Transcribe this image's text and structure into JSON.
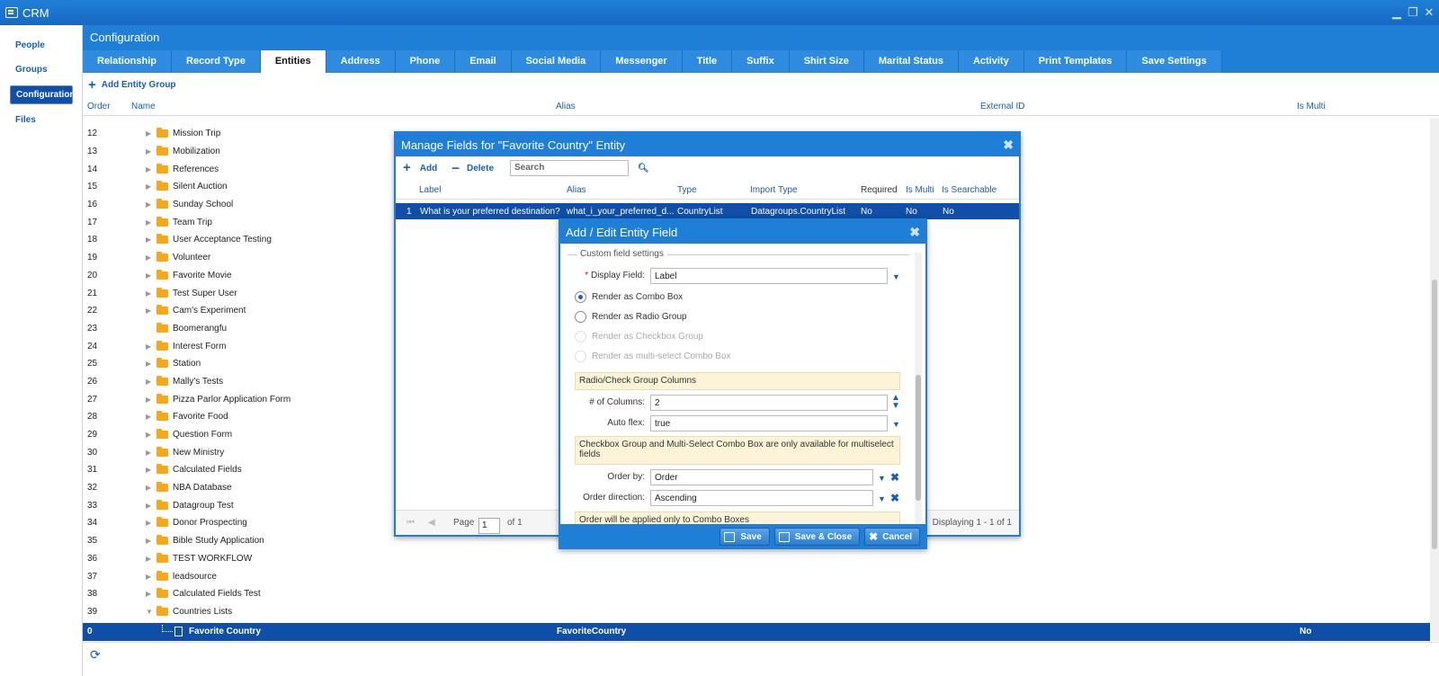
{
  "app": {
    "title": "CRM"
  },
  "sidebar": {
    "items": [
      {
        "label": "People"
      },
      {
        "label": "Groups"
      },
      {
        "label": "Configuration"
      },
      {
        "label": "Files"
      }
    ]
  },
  "config": {
    "title": "Configuration",
    "tabs": [
      "Relationship",
      "Record Type",
      "Entities",
      "Address",
      "Phone",
      "Email",
      "Social Media",
      "Messenger",
      "Title",
      "Suffix",
      "Shirt Size",
      "Marital Status",
      "Activity",
      "Print Templates",
      "Save Settings"
    ],
    "active_tab": "Entities",
    "add_group_label": "Add Entity Group",
    "columns": {
      "order": "Order",
      "name": "Name",
      "alias": "Alias",
      "external_id": "External ID",
      "is_multi": "Is Multi"
    },
    "rows": [
      {
        "order": "12",
        "name": "Mission Trip"
      },
      {
        "order": "13",
        "name": "Mobilization"
      },
      {
        "order": "14",
        "name": "References"
      },
      {
        "order": "15",
        "name": "Silent Auction"
      },
      {
        "order": "16",
        "name": "Sunday School"
      },
      {
        "order": "17",
        "name": "Team Trip"
      },
      {
        "order": "18",
        "name": "User Acceptance Testing"
      },
      {
        "order": "19",
        "name": "Volunteer"
      },
      {
        "order": "20",
        "name": "Favorite Movie"
      },
      {
        "order": "21",
        "name": "Test Super User"
      },
      {
        "order": "22",
        "name": "Cam's Experiment"
      },
      {
        "order": "23",
        "name": "Boomerangfu"
      },
      {
        "order": "24",
        "name": "Interest Form"
      },
      {
        "order": "25",
        "name": "Station"
      },
      {
        "order": "26",
        "name": "Mally's Tests"
      },
      {
        "order": "27",
        "name": "Pizza Parlor Application Form"
      },
      {
        "order": "28",
        "name": "Favorite Food"
      },
      {
        "order": "29",
        "name": "Question Form"
      },
      {
        "order": "30",
        "name": "New Ministry"
      },
      {
        "order": "31",
        "name": "Calculated Fields"
      },
      {
        "order": "32",
        "name": "NBA Database"
      },
      {
        "order": "33",
        "name": "Datagroup Test"
      },
      {
        "order": "34",
        "name": "Donor Prospecting"
      },
      {
        "order": "35",
        "name": "Bible Study Application"
      },
      {
        "order": "36",
        "name": "TEST WORKFLOW"
      },
      {
        "order": "37",
        "name": "leadsource"
      },
      {
        "order": "38",
        "name": "Calculated Fields Test"
      },
      {
        "order": "39",
        "name": "Countries Lists"
      }
    ],
    "selected_row": {
      "order": "0",
      "name": "Favorite Country",
      "alias": "FavoriteCountry",
      "is_multi": "No"
    }
  },
  "manage_fields": {
    "title": "Manage Fields for \"Favorite Country\" Entity",
    "add_label": "Add",
    "delete_label": "Delete",
    "search_placeholder": "Search",
    "columns": {
      "label": "Label",
      "alias": "Alias",
      "type": "Type",
      "import_type": "Import Type",
      "required": "Required",
      "is_multi": "Is Multi",
      "is_searchable": "Is Searchable"
    },
    "row": {
      "num": "1",
      "label": "What is your preferred destination?",
      "alias": "what_i_your_preferred_d...",
      "type": "CountryList",
      "import_type": "Datagroups.CountryList",
      "required": "No",
      "is_multi": "No",
      "is_searchable": "No"
    },
    "pager": {
      "page_label": "Page",
      "page": "1",
      "of": "of 1",
      "displaying": "Displaying 1 - 1 of 1"
    }
  },
  "edit_field": {
    "title": "Add / Edit Entity Field",
    "legend": "Custom field settings",
    "display_field_label": "Display Field:",
    "display_field_value": "Label",
    "radios": [
      {
        "label": "Render as Combo Box",
        "checked": true,
        "disabled": false
      },
      {
        "label": "Render as Radio Group",
        "checked": false,
        "disabled": false
      },
      {
        "label": "Render as Checkbox Group",
        "checked": false,
        "disabled": true
      },
      {
        "label": "Render as multi-select Combo Box",
        "checked": false,
        "disabled": true
      }
    ],
    "group_columns_note": "Radio/Check Group Columns",
    "columns_label": "# of Columns:",
    "columns_value": "2",
    "autoflex_label": "Auto flex:",
    "autoflex_value": "true",
    "multiselect_note": "Checkbox Group and Multi-Select Combo Box are only available for multiselect fields",
    "order_by_label": "Order by:",
    "order_by_value": "Order",
    "order_dir_label": "Order direction:",
    "order_dir_value": "Ascending",
    "order_note": "Order will be applied only to Combo Boxes",
    "buttons": {
      "save": "Save",
      "save_close": "Save & Close",
      "cancel": "Cancel"
    }
  }
}
